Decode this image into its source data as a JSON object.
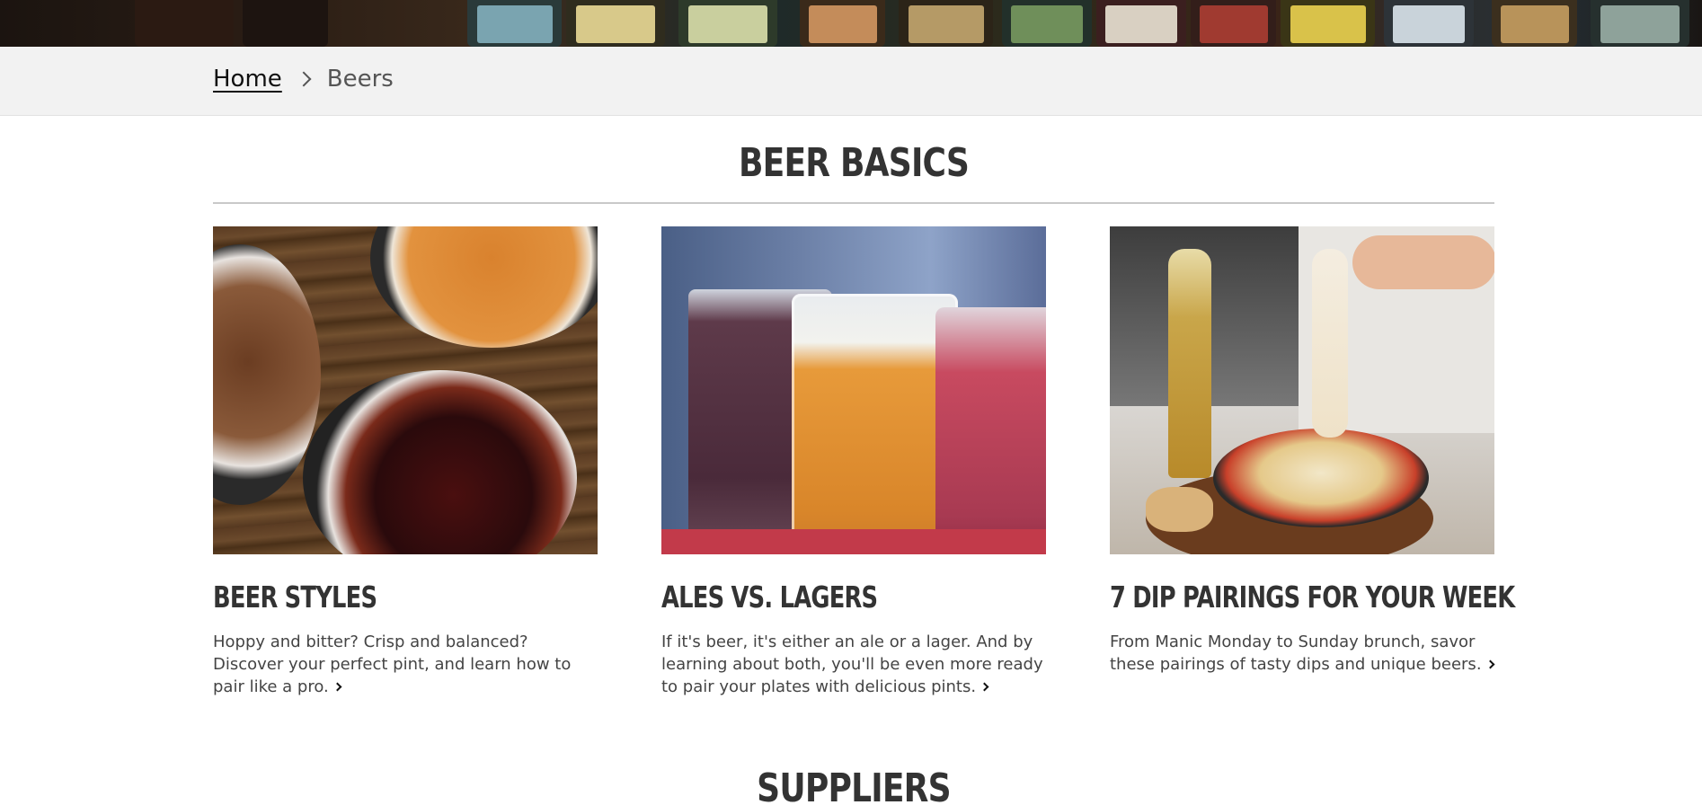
{
  "breadcrumb": {
    "home": "Home",
    "current": "Beers"
  },
  "sections": {
    "basics_title": "BEER BASICS",
    "suppliers_title": "SUPPLIERS"
  },
  "cards": [
    {
      "title": "BEER STYLES",
      "description": "Hoppy and bitter? Crisp and balanced?  Discover your perfect pint, and learn how to pair like a pro."
    },
    {
      "title": "ALES VS. LAGERS",
      "description": "If it's beer, it's either an ale or a lager. And by learning about both, you'll be even more ready to pair your plates with delicious pints."
    },
    {
      "title": "7 DIP PAIRINGS FOR YOUR WEEK",
      "description": "From Manic Monday to Sunday brunch, savor these pairings of tasty dips and unique beers."
    }
  ],
  "icons": {
    "breadcrumb_separator": "chevron-right-icon",
    "read_more": "chevron-right-icon"
  },
  "colors": {
    "heading": "#333333",
    "breadcrumb_bar": "#f2f2f2",
    "divider": "#c9c9c9"
  }
}
